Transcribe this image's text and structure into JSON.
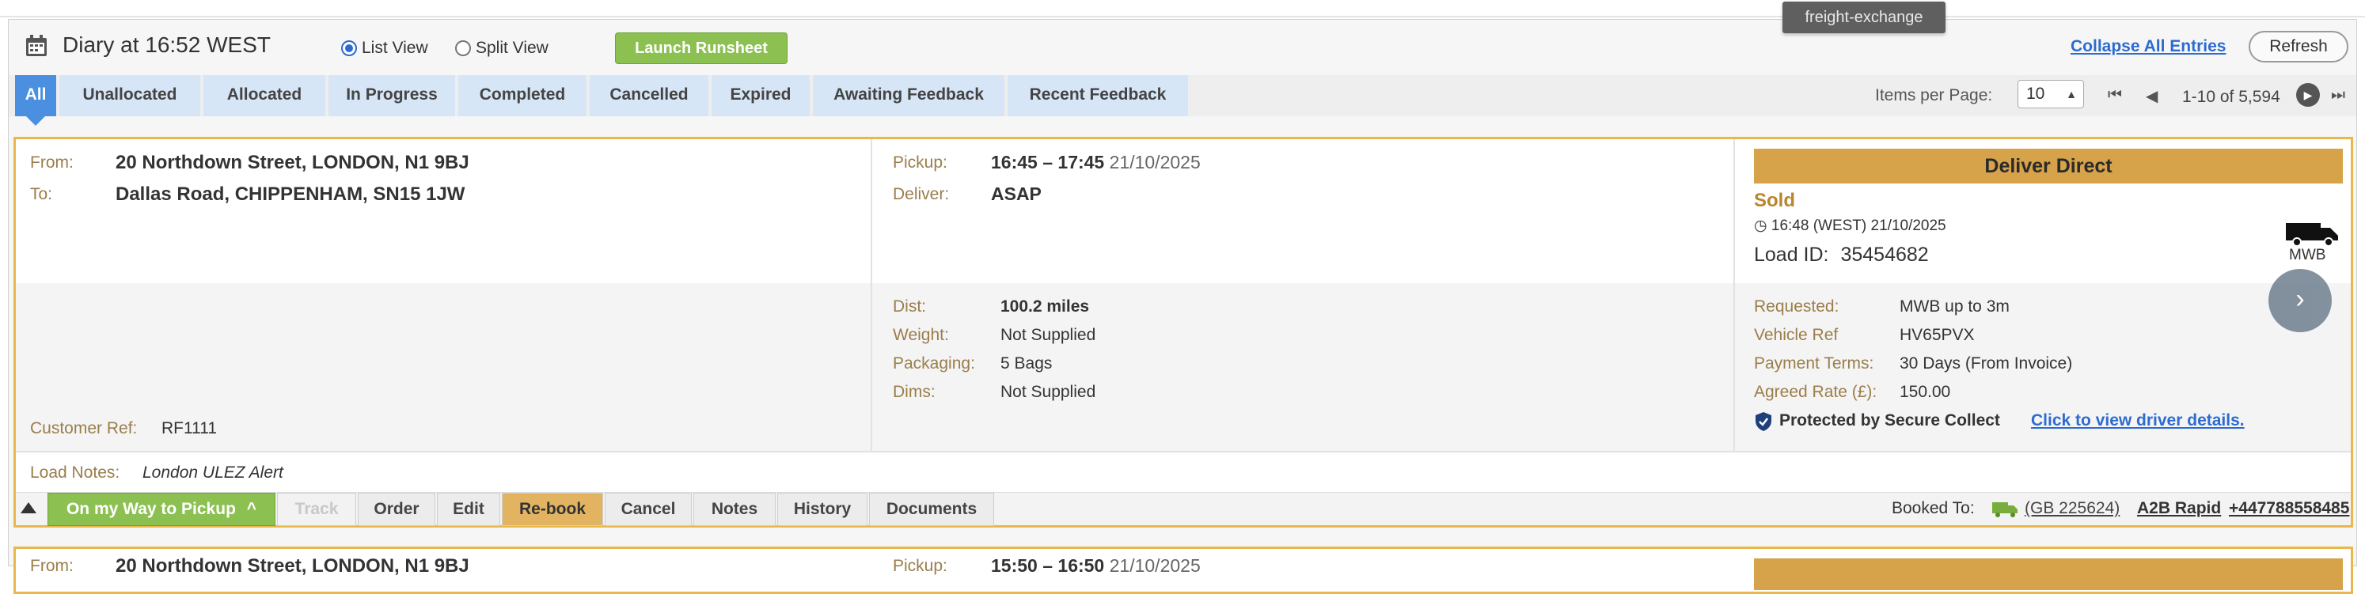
{
  "tooltip": "freight-exchange",
  "header": {
    "title": "Diary at 16:52 WEST",
    "view_options": [
      "List View",
      "Split View"
    ],
    "launch_label": "Launch Runsheet",
    "collapse_label": "Collapse All Entries",
    "refresh_label": "Refresh"
  },
  "tabs": [
    "All",
    "Unallocated",
    "Allocated",
    "In Progress",
    "Completed",
    "Cancelled",
    "Expired",
    "Awaiting Feedback",
    "Recent Feedback"
  ],
  "pagination": {
    "items_per_page_label": "Items per Page:",
    "items_per_page_value": "10",
    "range": "1-10 of 5,594"
  },
  "colors": {
    "accent_gold": "#d6a24a",
    "tab_active": "#4a8fe0",
    "launch_green": "#8cc152",
    "link_blue": "#2d6bd1"
  },
  "entry": {
    "from_label": "From:",
    "from": "20 Northdown Street, LONDON, N1 9BJ",
    "to_label": "To:",
    "to": "Dallas Road, CHIPPENHAM, SN15 1JW",
    "pickup_label": "Pickup:",
    "pickup_time": "16:45 – 17:45",
    "pickup_date": "21/10/2025",
    "deliver_label": "Deliver:",
    "deliver": "ASAP",
    "dist_label": "Dist:",
    "dist": "100.2 miles",
    "weight_label": "Weight:",
    "weight": "Not Supplied",
    "packaging_label": "Packaging:",
    "packaging": "5 Bags",
    "dims_label": "Dims:",
    "dims": "Not Supplied",
    "customer_ref_label": "Customer Ref:",
    "customer_ref": "RF1111",
    "status_bar": "Deliver Direct",
    "status": "Sold",
    "status_time": "16:48",
    "status_zone": "(WEST)",
    "status_date": "21/10/2025",
    "load_id_label": "Load ID:",
    "load_id": "35454682",
    "vehicle_code": "MWB",
    "requested_label": "Requested:",
    "requested": "MWB up to 3m",
    "vehicle_ref_label": "Vehicle Ref",
    "vehicle_ref": "HV65PVX",
    "payment_terms_label": "Payment Terms:",
    "payment_terms": "30 Days (From Invoice)",
    "agreed_rate_label": "Agreed Rate (£):",
    "agreed_rate": "150.00",
    "secure_label": "Protected by Secure Collect",
    "driver_link": "Click to view driver details.",
    "load_notes_label": "Load Notes:",
    "load_notes": "London ULEZ Alert",
    "actions": {
      "on_my_way": "On my Way to Pickup",
      "track": "Track",
      "order": "Order",
      "edit": "Edit",
      "rebook": "Re-book",
      "cancel": "Cancel",
      "notes": "Notes",
      "history": "History",
      "documents": "Documents"
    },
    "booked_to_label": "Booked To:",
    "booked_to_gb": "(GB 225624)",
    "booked_to_name": "A2B Rapid",
    "booked_to_phone": "+447788558485"
  },
  "entry2": {
    "from_label": "From:",
    "from": "20 Northdown Street, LONDON, N1 9BJ",
    "pickup_label": "Pickup:",
    "pickup_time": "15:50 – 16:50",
    "pickup_date": "21/10/2025"
  }
}
